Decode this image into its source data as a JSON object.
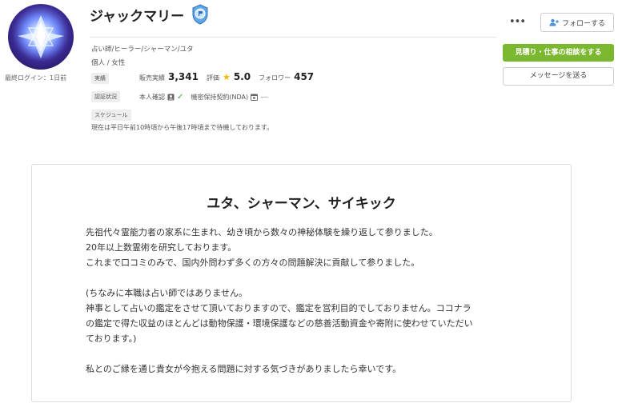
{
  "profile": {
    "last_login": "最終ログイン：1日前",
    "name": "ジャックマリー",
    "badge_icon": "rank-badge-icon",
    "categories": "占い師/ヒーラー/シャーマン/ユタ",
    "gender": "個人 /  女性"
  },
  "actions": {
    "more": "•••",
    "follow_label": "フォローする",
    "consult_label": "見積り・仕事の相談をする",
    "message_label": "メッセージを送る",
    "accent_color": "#7cb82f"
  },
  "stats": {
    "tag": "実績",
    "sales_label": "販売実績",
    "sales_value": "3,341",
    "rating_label": "評価",
    "rating_value": "5.0",
    "followers_label": "フォロワー",
    "followers_value": "457"
  },
  "verification": {
    "tag": "認証状況",
    "identity_label": "本人確認",
    "nda_label": "機密保持契約(NDA)",
    "nda_status": "—"
  },
  "schedule": {
    "tag": "スケジュール",
    "text": "現在は平日午前10時頃から午後17時頃まで待機しております。"
  },
  "intro": {
    "title": "ユタ、シャーマン、サイキック",
    "lines": [
      "先祖代々霊能力者の家系に生まれ、幼き頃から数々の神秘体験を繰り返して参りました。",
      "20年以上数霊術を研究しております。",
      "これまで口コミのみで、国内外問わず多くの方々の問題解決に貢献して参りました。",
      "",
      "(ちなみに本職は占い師ではありません。",
      "神事として占いの鑑定をさせて頂いておりますので、鑑定を営利目的でしておりません。ココナラ",
      "の鑑定で得た収益のほとんどは動物保護・環境保護などの慈善活動資金や寄附に使わせていただい",
      "ております。)",
      "",
      "私とのご縁を通じ貴女が今抱える問題に対する気づきがありましたら幸いです。"
    ]
  }
}
